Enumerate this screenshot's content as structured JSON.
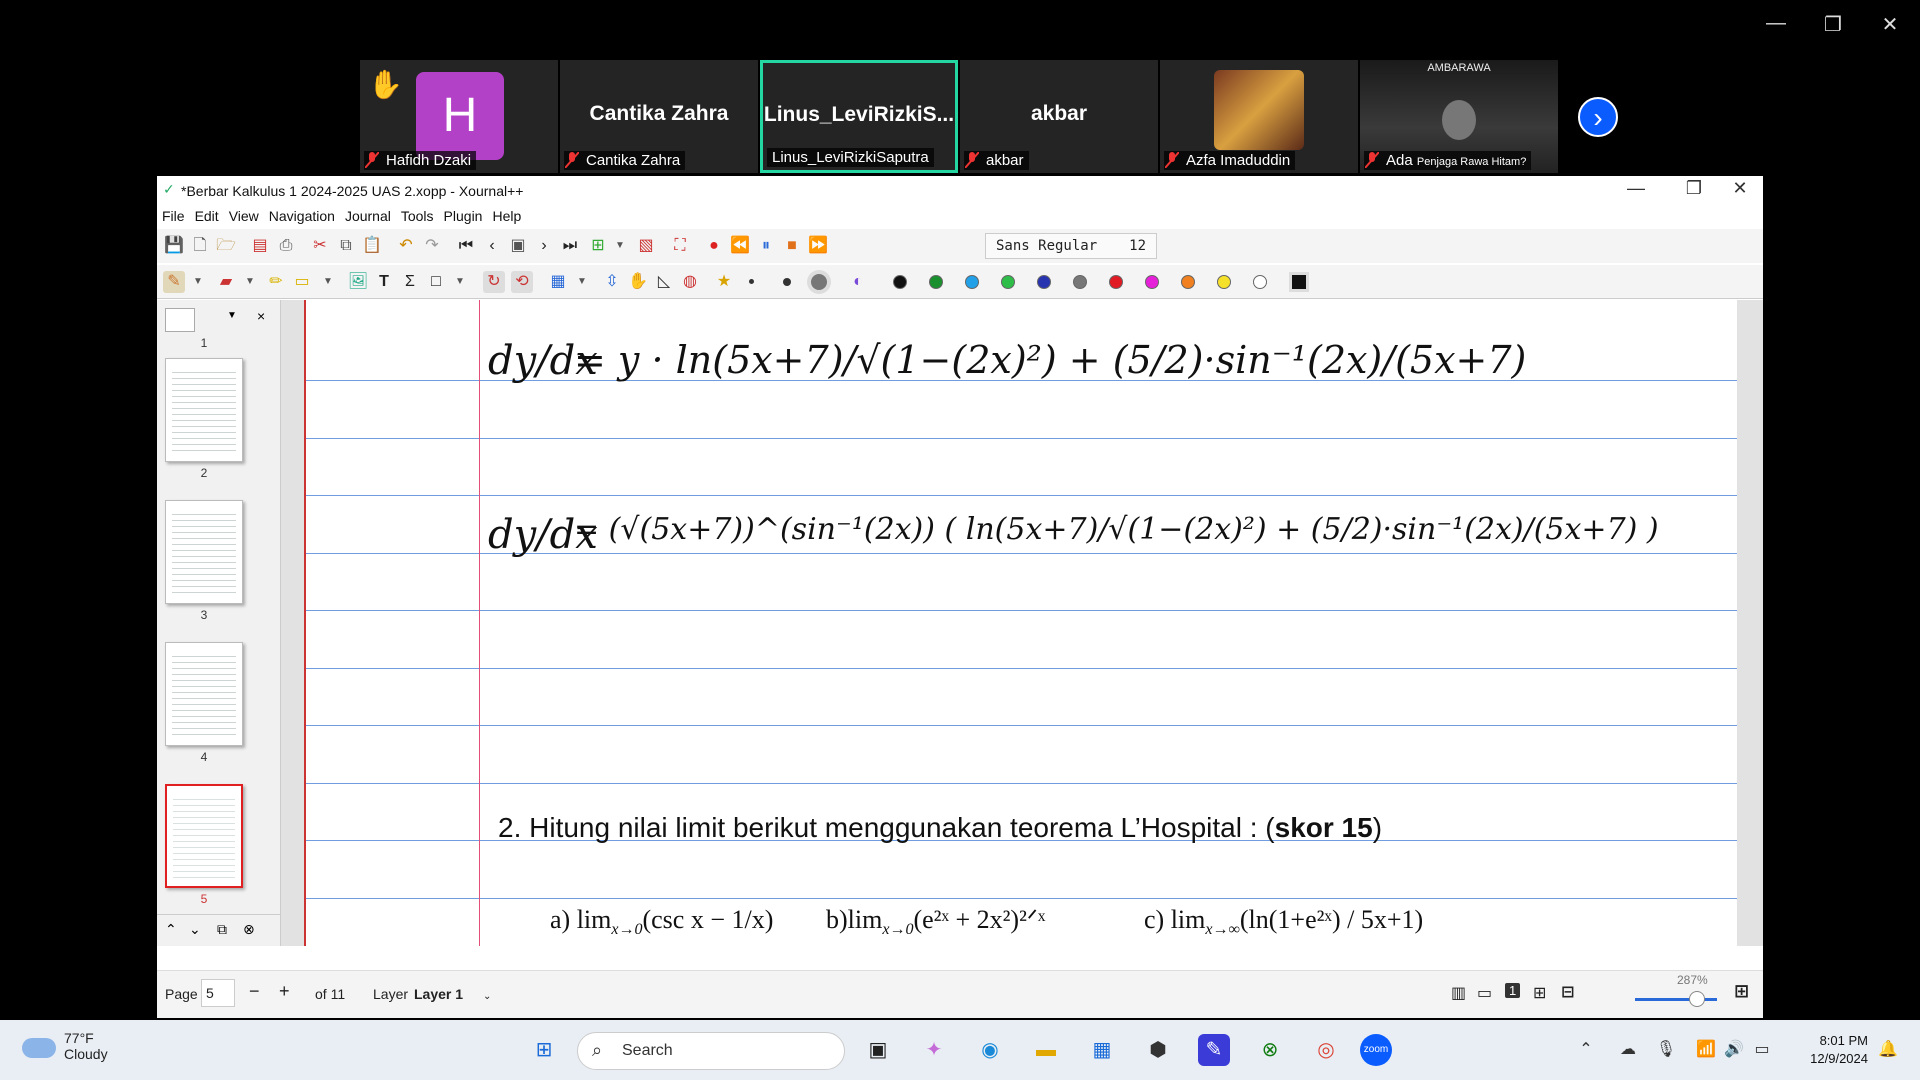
{
  "outer_window": {
    "min": "—",
    "restore": "❐",
    "close": "✕"
  },
  "zoom": {
    "participants": [
      {
        "name": "Hafidh Dzaki",
        "avatar_letter": "H",
        "hand_raised": true
      },
      {
        "name": "Cantika Zahra",
        "display": "Cantika Zahra"
      },
      {
        "name": "Linus_LeviRizkiSaputra",
        "display": "Linus_LeviRizkiS...",
        "active": true
      },
      {
        "name": "akbar",
        "display": "akbar"
      },
      {
        "name": "Azfa Imaduddin"
      },
      {
        "name": "Ada",
        "overlay": "Penjaga Rawa Hitam?",
        "video_title": "AMBARAWA"
      }
    ],
    "next_icon": "›"
  },
  "xournal": {
    "title": "*Berbar Kalkulus 1 2024-2025 UAS 2.xopp - Xournal++",
    "menus": [
      "File",
      "Edit",
      "View",
      "Navigation",
      "Journal",
      "Tools",
      "Plugin",
      "Help"
    ],
    "font": {
      "name": "Sans Regular",
      "size": "12"
    },
    "colors": [
      "#111111",
      "#1a8f2e",
      "#22a0e8",
      "#2fbd4a",
      "#2833b0",
      "#777777",
      "#e01b24",
      "#e620d8",
      "#f08020",
      "#f5e12a",
      "#ffffff"
    ],
    "sidebar_pages": [
      "1",
      "2",
      "3",
      "4",
      "5"
    ],
    "content": {
      "eq1_lhs": "dy/dx",
      "eq1_rhs": "= y · ln(5x+7)/√(1−(2x)²) + (5/2)·sin⁻¹(2x)/(5x+7)",
      "eq2_lhs": "dy/dx",
      "eq2_rhs": "= (√(5x+7))^(sin⁻¹(2x)) ( ln(5x+7)/√(1−(2x)²) + (5/2)·sin⁻¹(2x)/(5x+7) )",
      "q2_prefix": "2.  Hitung nilai limit berikut menggunakan teorema L’Hospital : (",
      "q2_bold": "skor 15",
      "q2_suffix": ")",
      "part_a": "a)  lim",
      "part_a_sub": "x→0",
      "part_a_rest": "(csc x  − 1/x)",
      "part_b": "b)lim",
      "part_b_sub": "x→0",
      "part_b_rest": "(e²ˣ + 2x²)²ᐟˣ",
      "part_c": "c) lim",
      "part_c_sub": "x→∞",
      "part_c_rest": "(ln(1+e²ˣ) / 5x+1)"
    },
    "status": {
      "page_label": "Page",
      "page_value": "5",
      "of_label": "of 11",
      "layer_label": "Layer",
      "layer_value": "Layer 1",
      "zoom": "287%"
    }
  },
  "taskbar": {
    "weather_temp": "77°F",
    "weather_desc": "Cloudy",
    "search_placeholder": "Search",
    "time": "8:01 PM",
    "date": "12/9/2024"
  }
}
